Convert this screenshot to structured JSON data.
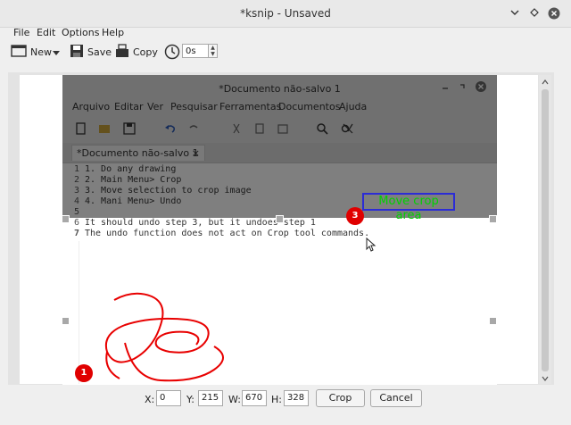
{
  "window": {
    "title": "*ksnip - Unsaved"
  },
  "menubar": [
    "File",
    "Edit",
    "Options",
    "Help"
  ],
  "toolbar": {
    "new_label": "New",
    "save_label": "Save",
    "copy_label": "Copy",
    "delay_value": "0s"
  },
  "screenshot": {
    "title": "*Documento não-salvo 1",
    "menu": [
      "Arquivo",
      "Editar",
      "Ver",
      "Pesquisar",
      "Ferramentas",
      "Documentos",
      "Ajuda"
    ],
    "tab": "*Documento não-salvo 1",
    "lines": [
      {
        "num": "1",
        "text": "1. Do any drawing"
      },
      {
        "num": "2",
        "text": "2. Main Menu> Crop"
      },
      {
        "num": "3",
        "text": "3. Move selection to crop image"
      },
      {
        "num": "4",
        "text": "4. Mani Menu> Undo"
      },
      {
        "num": "5",
        "text": ""
      },
      {
        "num": "6",
        "text": "It should undo step 3, but it undoes step 1"
      },
      {
        "num": "7",
        "text": "The undo function does not act on Crop tool commands."
      }
    ],
    "crop_label": "Move crop area",
    "badges": [
      "3",
      "1"
    ]
  },
  "crop": {
    "x_label": "X:",
    "x": "0",
    "y_label": "Y:",
    "y": "215",
    "w_label": "W:",
    "w": "670",
    "h_label": "H:",
    "h": "328",
    "crop_label": "Crop",
    "cancel_label": "Cancel"
  }
}
